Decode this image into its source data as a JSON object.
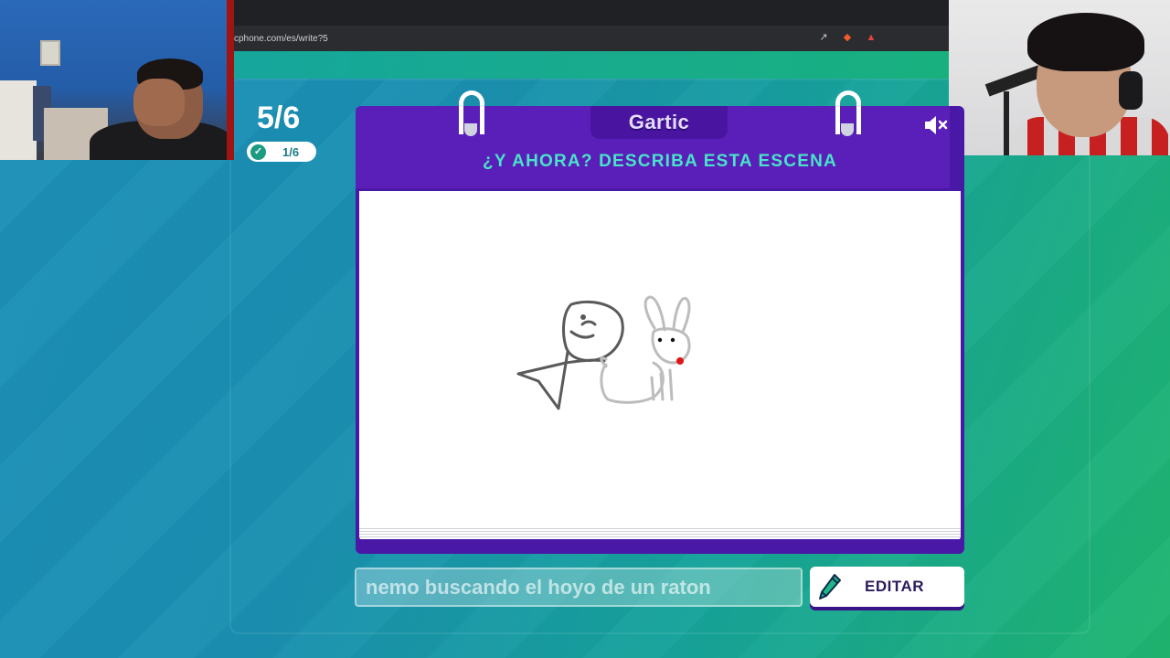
{
  "browser": {
    "url": "cphone.com/es/write?5",
    "icons": [
      "share-icon",
      "brave-shield-icon",
      "brave-rewards-icon"
    ]
  },
  "game": {
    "round": "5/6",
    "done_count": "1/6",
    "logo": "Gartic",
    "prompt_title": "¿Y AHORA? DESCRIBA ESTA ESCENA",
    "answer_value": "nemo buscando el hoyo de un raton",
    "edit_label": "EDITAR"
  },
  "colors": {
    "card_purple": "#4a18a7",
    "title_teal": "#49e3c9",
    "bg_blue": "#1d8fb8",
    "bg_green": "#1fb56f"
  }
}
